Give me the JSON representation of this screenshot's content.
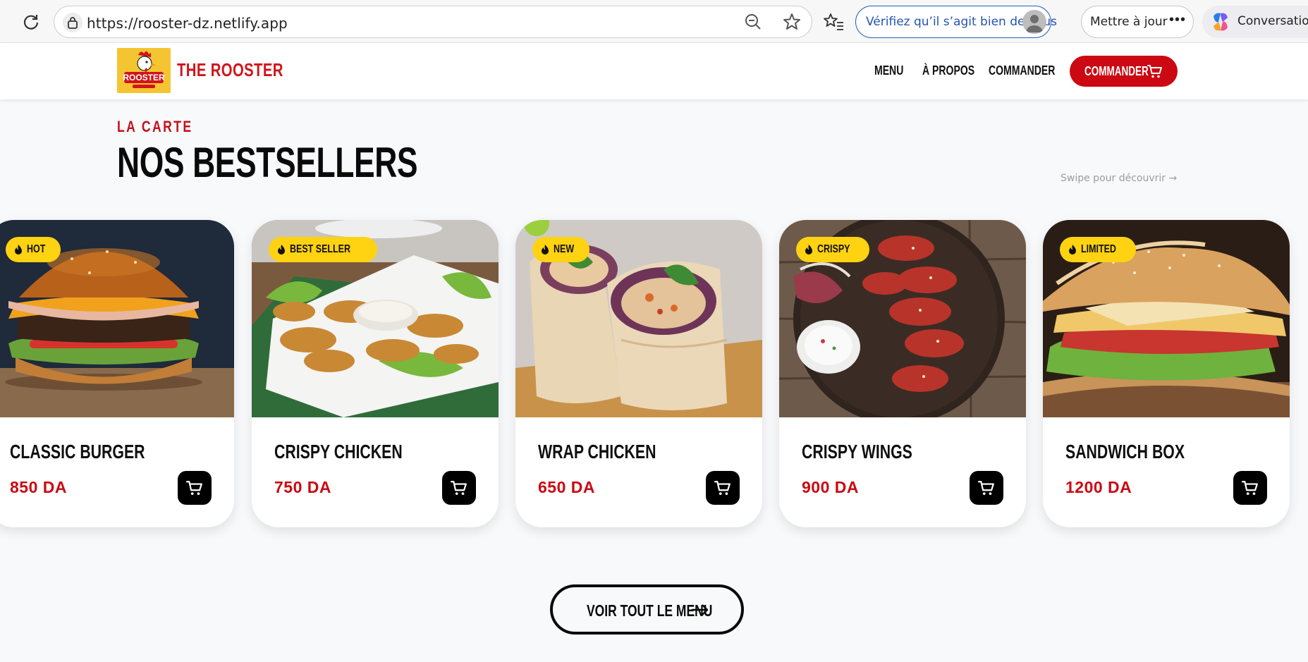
{
  "browser": {
    "url": "https://rooster-dz.netlify.app",
    "verify_label": "Vérifiez qu’il s’agit bien de vous",
    "update_label": "Mettre à jour",
    "more_label": "•••",
    "copilot_label": "Conversation"
  },
  "site": {
    "brand": "THE ROOSTER",
    "logo_text": "ROOSTER",
    "nav": {
      "menu": "MENU",
      "about": "À PROPOS",
      "order": "COMMANDER",
      "cta": "COMMANDER"
    },
    "colors": {
      "brand_red": "#cc0812",
      "badge_yellow": "#ffd212",
      "logo_yellow": "#f5c531"
    }
  },
  "section": {
    "eyebrow": "LA CARTE",
    "title": "NOS BESTSELLERS",
    "swipe_hint": "Swipe pour découvrir →"
  },
  "products": [
    {
      "badge": "HOT",
      "name": "CLASSIC BURGER",
      "price": "850 DA",
      "photo": "burger"
    },
    {
      "badge": "BEST SELLER",
      "name": "CRISPY CHICKEN",
      "price": "750 DA",
      "photo": "crispy-chicken"
    },
    {
      "badge": "NEW",
      "name": "WRAP CHICKEN",
      "price": "650 DA",
      "photo": "wrap"
    },
    {
      "badge": "CRISPY",
      "name": "CRISPY WINGS",
      "price": "900 DA",
      "photo": "wings"
    },
    {
      "badge": "LIMITED",
      "name": "SANDWICH BOX",
      "price": "1200 DA",
      "photo": "sandwich"
    }
  ],
  "cta": {
    "label": "VOIR TOUT LE MENU"
  }
}
